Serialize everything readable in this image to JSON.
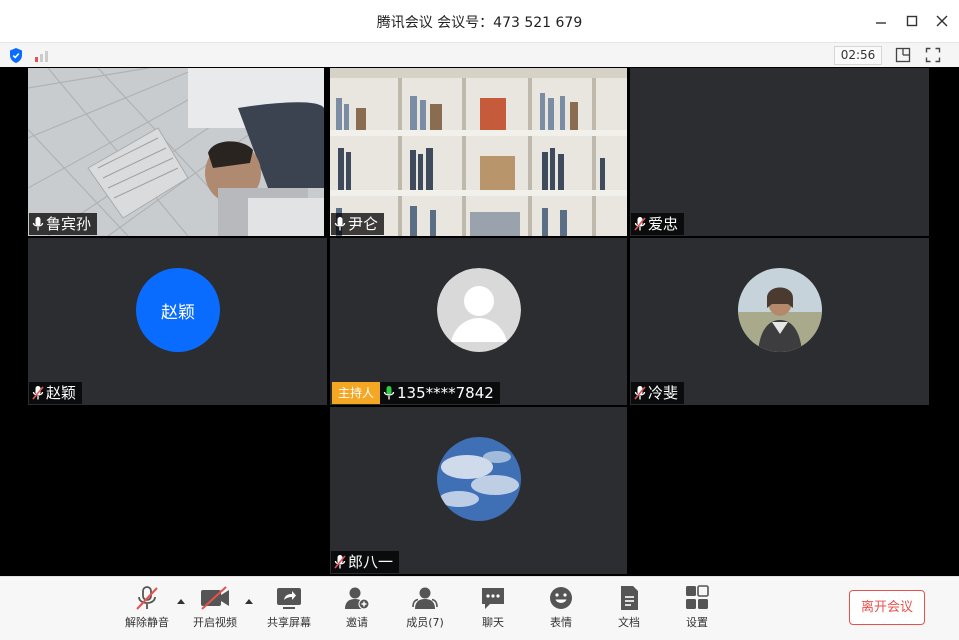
{
  "window": {
    "title": "腾讯会议 会议号：473 521 679",
    "timer": "02:56"
  },
  "participants": [
    {
      "name": "鲁宾孙",
      "mic": "on"
    },
    {
      "name": "尹仑",
      "mic": "on"
    },
    {
      "name": "爱忠",
      "mic": "muted"
    },
    {
      "name": "赵颖",
      "mic": "muted",
      "avatar_text": "赵颖"
    },
    {
      "name": "135****7842",
      "mic": "active",
      "host_badge": "主持人"
    },
    {
      "name": "冷斐",
      "mic": "muted"
    },
    {
      "name": "郎八一",
      "mic": "muted"
    }
  ],
  "toolbar": {
    "unmute": "解除静音",
    "start_video": "开启视频",
    "share_screen": "共享屏幕",
    "invite": "邀请",
    "members": "成员(7)",
    "chat": "聊天",
    "reactions": "表情",
    "docs": "文档",
    "settings": "设置",
    "leave": "离开会议"
  },
  "colors": {
    "accent": "#0a6cff",
    "host_badge": "#f5a623",
    "leave": "#e8524c",
    "muted_icon": "#e8524c",
    "active_mic": "#2ecc40"
  },
  "icons": [
    "shield-icon",
    "signal-icon",
    "layout-icon",
    "fullscreen-icon",
    "mic-icon",
    "mic-muted-icon",
    "video-off-icon",
    "share-icon",
    "add-user-icon",
    "members-icon",
    "chat-icon",
    "emoji-icon",
    "document-icon",
    "grid-icon"
  ]
}
